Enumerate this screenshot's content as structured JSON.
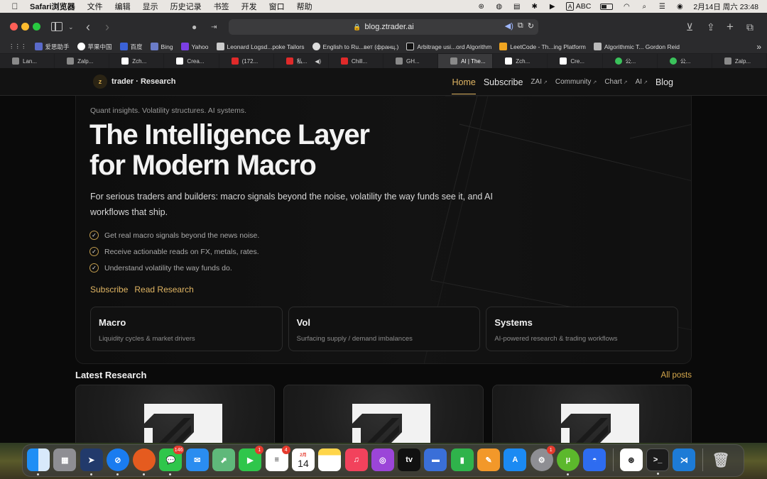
{
  "menubar": {
    "app_name": "Safari浏览器",
    "items": [
      "文件",
      "编辑",
      "显示",
      "历史记录",
      "书签",
      "开发",
      "窗口",
      "帮助"
    ],
    "input_mode": "ABC",
    "datetime": "2月14日 周六  23:48"
  },
  "browser": {
    "url": "blog.ztrader.ai",
    "favorites": [
      {
        "label": "爱思助手",
        "icon": "aisi-icon"
      },
      {
        "label": "苹果中国",
        "icon": "apple-icon"
      },
      {
        "label": "百度",
        "icon": "baidu-icon"
      },
      {
        "label": "Bing",
        "icon": "bing-icon"
      },
      {
        "label": "Yahoo",
        "icon": "yahoo-icon"
      },
      {
        "label": "Leonard Logsd...poke Tailors",
        "icon": "tailor-icon"
      },
      {
        "label": "English to Ru...вет (франц.)",
        "icon": "globe-icon"
      },
      {
        "label": "Arbitrage usi...ord Algorithm",
        "icon": "terminal-icon"
      },
      {
        "label": "LeetCode - Th...ing Platform",
        "icon": "leetcode-icon"
      },
      {
        "label": "Algorithmic T... Gordon Reid",
        "icon": "doc-icon"
      }
    ],
    "tabs": [
      {
        "label": "Lan...",
        "icon": "z"
      },
      {
        "label": "Zalp...",
        "icon": "z"
      },
      {
        "label": "Zch...",
        "icon": "black"
      },
      {
        "label": "Crea...",
        "icon": "black"
      },
      {
        "label": "(172...",
        "icon": "yt"
      },
      {
        "label": "私...",
        "icon": "yt"
      },
      {
        "label": "Chill...",
        "icon": "yt"
      },
      {
        "label": "GH...",
        "icon": "z"
      },
      {
        "label": "AI | The...",
        "icon": "z"
      },
      {
        "label": "Zch...",
        "icon": "black"
      },
      {
        "label": "Cre...",
        "icon": "black"
      },
      {
        "label": "公...",
        "icon": "wx"
      },
      {
        "label": "公...",
        "icon": "wx"
      },
      {
        "label": "Zalp...",
        "icon": "z"
      }
    ],
    "active_tab_index": 8
  },
  "site": {
    "logo_letter": "z",
    "logo_text": "trader · Research",
    "nav": {
      "home": "Home",
      "subscribe": "Subscribe",
      "zai": "ZAI",
      "community": "Community",
      "chart": "Chart",
      "ai": "AI",
      "blog": "Blog",
      "external_arrow": "↗"
    },
    "hero": {
      "tagline": "Quant insights. Volatility structures. AI systems.",
      "title_line1": "The Intelligence Layer",
      "title_line2": "for Modern Macro",
      "lead": "For serious traders and builders: macro signals beyond the noise, volatility the way funds see it, and AI workflows that ship.",
      "checks": [
        "Get real macro signals beyond the news noise.",
        "Receive actionable reads on FX, metals, rates.",
        "Understand volatility the way funds do."
      ],
      "cta_subscribe": "Subscribe",
      "cta_read": "Read Research",
      "cards": [
        {
          "title": "Macro",
          "desc": "Liquidity cycles & market drivers"
        },
        {
          "title": "Vol",
          "desc": "Surfacing supply / demand imbalances"
        },
        {
          "title": "Systems",
          "desc": "AI-powered research & trading workflows"
        }
      ]
    },
    "latest": {
      "title": "Latest Research",
      "all_posts": "All posts"
    }
  },
  "dock": {
    "badges": {
      "messages": "146",
      "facetime": "1",
      "reminders": "4",
      "settings": "1"
    },
    "calendar_month": "2月",
    "calendar_day": "14",
    "tv_label": "tv"
  },
  "colors": {
    "accent": "#e0b563",
    "background": "#0a0a0a"
  }
}
